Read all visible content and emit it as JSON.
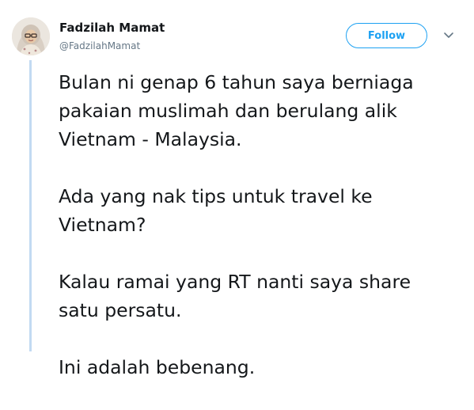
{
  "user": {
    "name": "Fadzilah Mamat",
    "handle": "@FadzilahMamat"
  },
  "follow_label": "Follow",
  "icons": {
    "avatar": "profile-photo",
    "more": "chevron-down-icon"
  },
  "colors": {
    "accent": "#1da1f2",
    "thread_line": "#c2daf2",
    "text": "#14171a",
    "muted": "#657786"
  },
  "tweet": {
    "paragraphs": [
      {
        "lines": [
          "Bulan ni genap 6 tahun saya berniaga",
          "pakaian muslimah dan berulang alik",
          "Vietnam - Malaysia."
        ]
      },
      {
        "lines": [
          "Ada yang nak tips untuk travel ke",
          "Vietnam?"
        ]
      },
      {
        "lines": [
          "Kalau ramai yang RT nanti saya share",
          "satu persatu."
        ]
      },
      {
        "lines": [
          "Ini adalah bebenang."
        ]
      }
    ]
  }
}
